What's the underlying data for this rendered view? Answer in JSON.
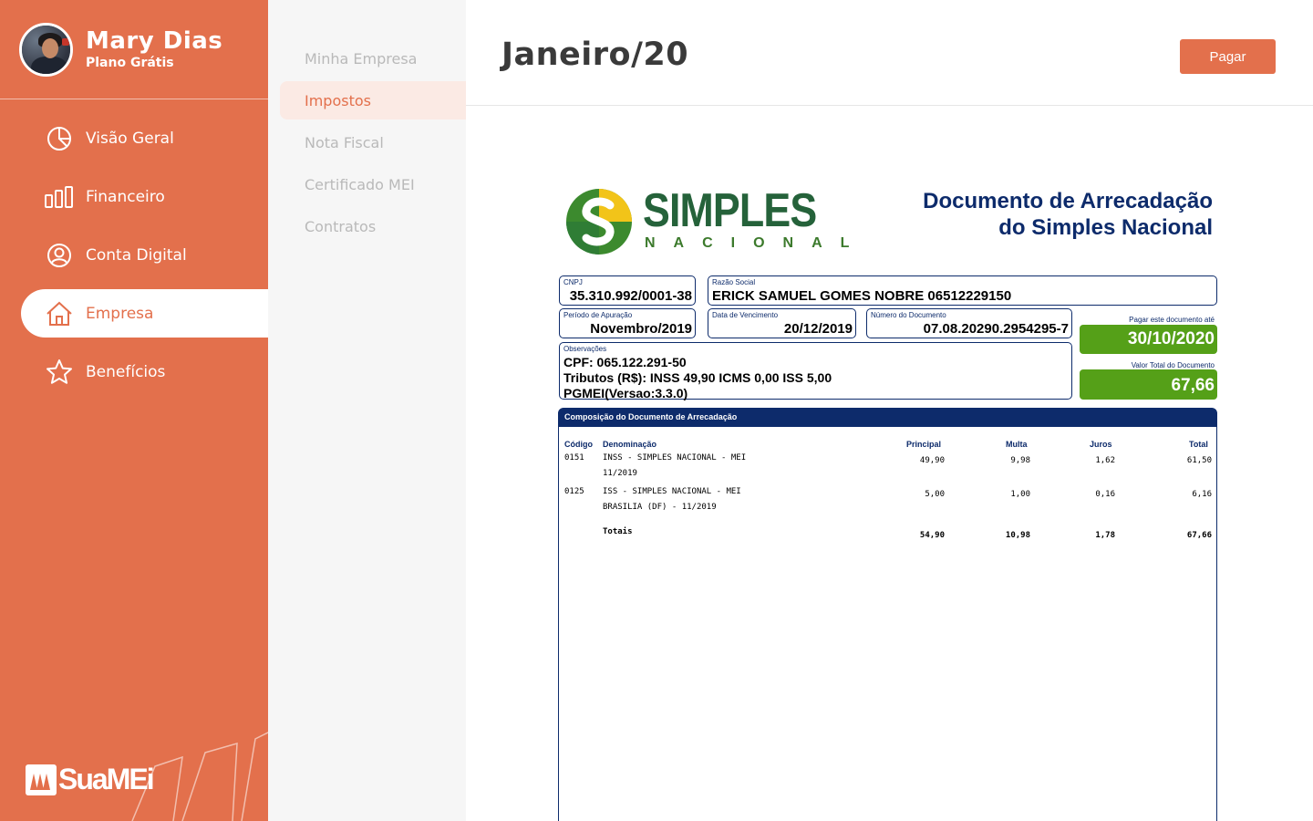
{
  "profile": {
    "name": "Mary Dias",
    "plan": "Plano Grátis"
  },
  "nav": [
    {
      "label": "Visão Geral",
      "icon": "pie-chart-icon",
      "active": false
    },
    {
      "label": "Financeiro",
      "icon": "bar-chart-icon",
      "active": false
    },
    {
      "label": "Conta Digital",
      "icon": "user-circle-icon",
      "active": false
    },
    {
      "label": "Empresa",
      "icon": "home-icon",
      "active": true
    },
    {
      "label": "Benefícios",
      "icon": "star-icon",
      "active": false
    }
  ],
  "brand": {
    "name": "SuaMEi"
  },
  "submenu": [
    {
      "label": "Minha Empresa",
      "active": false
    },
    {
      "label": "Impostos",
      "active": true
    },
    {
      "label": "Nota Fiscal",
      "active": false
    },
    {
      "label": "Certificado MEI",
      "active": false
    },
    {
      "label": "Contratos",
      "active": false
    }
  ],
  "header": {
    "title": "Janeiro/20",
    "pay_label": "Pagar"
  },
  "document": {
    "logo_simples": "SIMPLES",
    "logo_nacional": "NACIONAL",
    "title_line1": "Documento de Arrecadação",
    "title_line2": "do Simples Nacional",
    "cnpj_label": "CNPJ",
    "cnpj": "35.310.992/0001-38",
    "razao_label": "Razão Social",
    "razao": "ERICK SAMUEL GOMES NOBRE 06512229150",
    "periodo_label": "Período de Apuração",
    "periodo": "Novembro/2019",
    "vencimento_label": "Data de Vencimento",
    "vencimento": "20/12/2019",
    "numero_label": "Número do Documento",
    "numero": "07.08.20290.2954295-7",
    "pagar_ate_label": "Pagar este documento até",
    "pagar_ate": "30/10/2020",
    "obs_label": "Observações",
    "obs_line1": "CPF: 065.122.291-50",
    "obs_line2": "Tributos (R$): INSS 49,90 ICMS 0,00 ISS 5,00",
    "obs_line3": "PGMEI(Versao:3.3.0)",
    "valor_total_label": "Valor Total do Documento",
    "valor_total": "67,66",
    "composicao_title": "Composição do Documento de Arrecadação",
    "columns": [
      "Código",
      "Denominação",
      "Principal",
      "Multa",
      "Juros",
      "Total"
    ],
    "rows": [
      {
        "codigo": "0151",
        "den1": "INSS - SIMPLES NACIONAL - MEI",
        "den2": "11/2019",
        "principal": "49,90",
        "multa": "9,98",
        "juros": "1,62",
        "total": "61,50"
      },
      {
        "codigo": "0125",
        "den1": "ISS - SIMPLES NACIONAL - MEI",
        "den2": "BRASILIA (DF) - 11/2019",
        "principal": "5,00",
        "multa": "1,00",
        "juros": "0,16",
        "total": "6,16"
      }
    ],
    "totals": {
      "label": "Totais",
      "principal": "54,90",
      "multa": "10,98",
      "juros": "1,78",
      "total": "67,66"
    }
  }
}
